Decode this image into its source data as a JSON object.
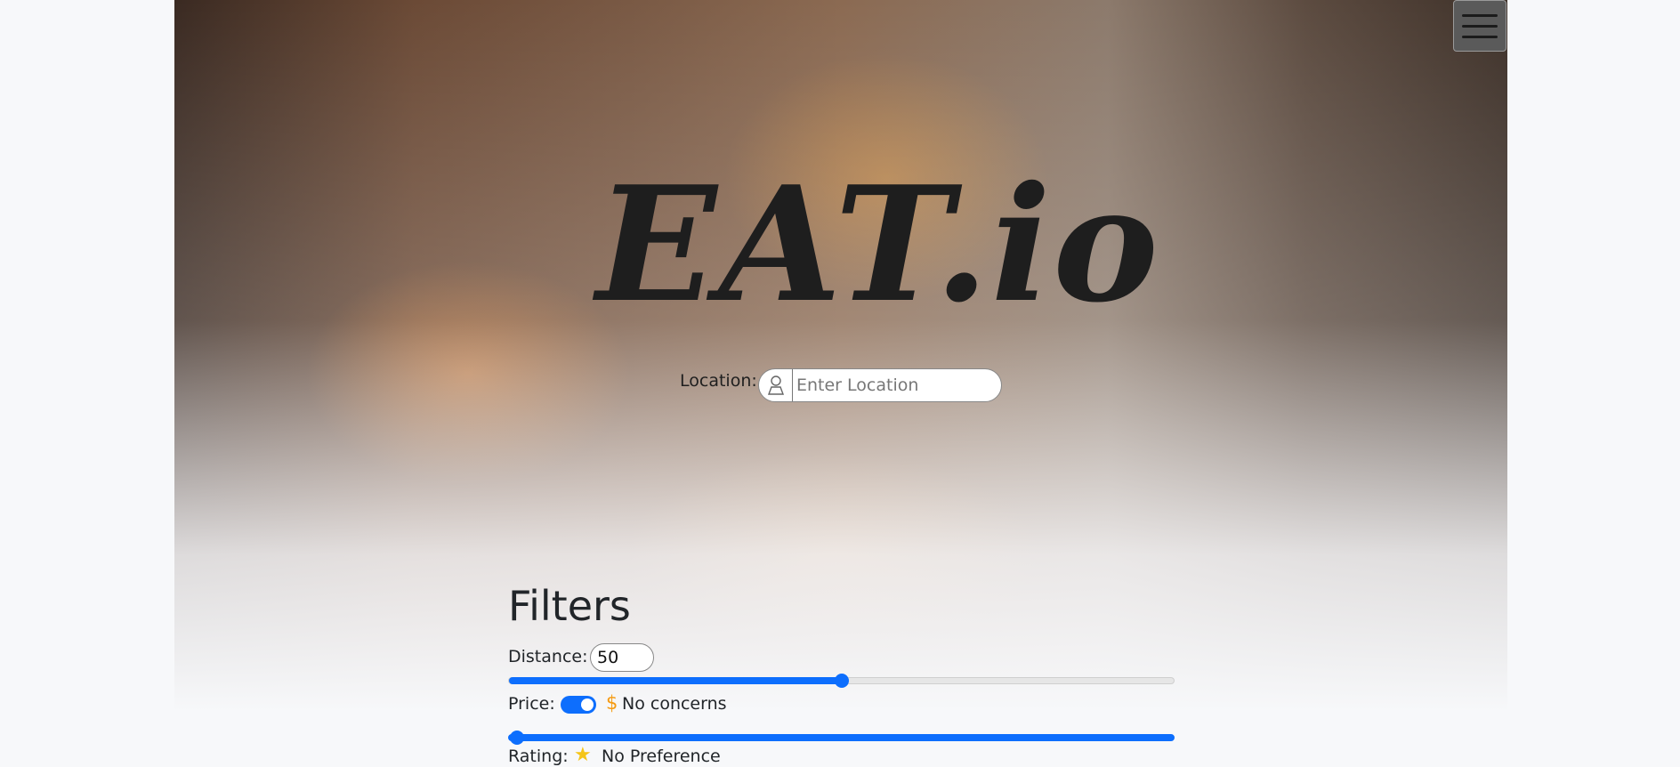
{
  "hero": {
    "logo_text": "EAT.io"
  },
  "menu": {
    "icon": "hamburger-menu-icon"
  },
  "location": {
    "label": "Location:",
    "placeholder": "Enter Location",
    "icon": "person-pin-icon"
  },
  "filters": {
    "title": "Filters",
    "distance": {
      "label": "Distance:",
      "value": "50",
      "slider_fraction": 0.5
    },
    "price": {
      "label": "Price:",
      "toggle_on": true,
      "icon": "dollar-icon",
      "icon_text": "$",
      "value_text": "No concerns",
      "slider_fraction": 0.0
    },
    "rating": {
      "label": "Rating:",
      "icon": "star-icon",
      "icon_text": "★",
      "value_text": "No Preference"
    }
  },
  "colors": {
    "accent": "#0d6efd",
    "price_icon": "#f59b12",
    "star_icon": "#f5c518"
  }
}
